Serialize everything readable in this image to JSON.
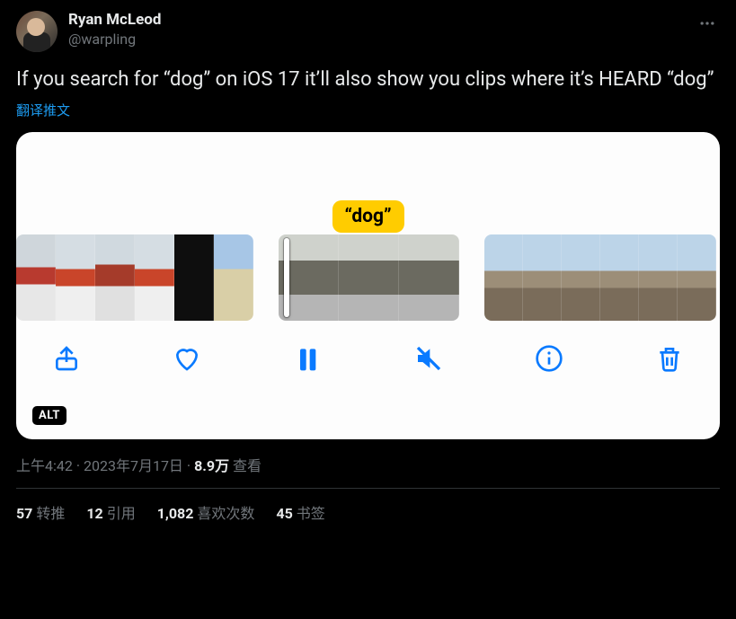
{
  "author": {
    "display_name": "Ryan McLeod",
    "handle": "@warpling"
  },
  "body": "If you search for “dog” on iOS 17 it’ll also show you clips where it’s HEARD “dog”",
  "translate_label": "翻译推文",
  "media": {
    "search_label": "“dog”",
    "alt_badge": "ALT",
    "toolbar": {
      "share": "share-icon",
      "like": "heart-icon",
      "pause": "pause-icon",
      "mute": "mute-icon",
      "info": "info-icon",
      "delete": "trash-icon"
    }
  },
  "meta": {
    "time": "上午4:42",
    "date": "2023年7月17日",
    "sep": " · ",
    "views_num": "8.9万",
    "views_label": " 查看"
  },
  "stats": {
    "retweets": {
      "num": "57",
      "label": "转推"
    },
    "quotes": {
      "num": "12",
      "label": "引用"
    },
    "likes": {
      "num": "1,082",
      "label": "喜欢次数"
    },
    "bookmarks": {
      "num": "45",
      "label": "书签"
    }
  }
}
